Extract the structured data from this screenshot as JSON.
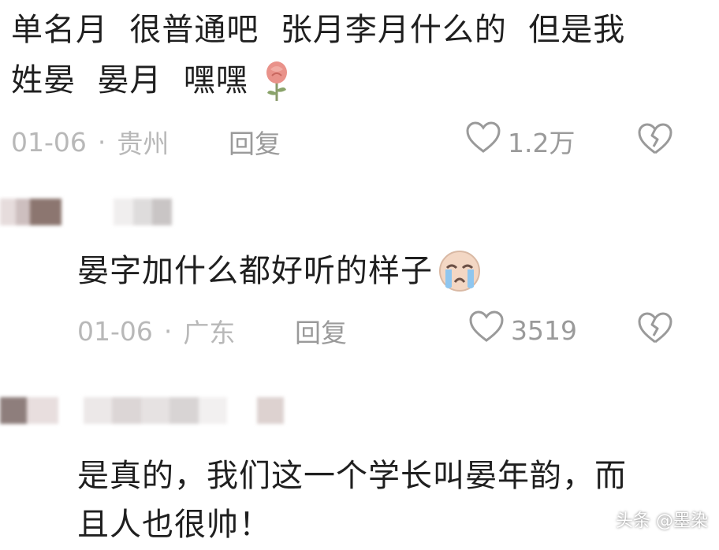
{
  "comments": [
    {
      "text_line1": "单名月  很普通吧  张月李月什么的  但是我",
      "text_line2": "姓晏  晏月  嘿嘿",
      "emoji_icon": "rose-icon",
      "date": "01-06",
      "separator": "·",
      "location": "贵州",
      "reply_label": "回复",
      "like_count": "1.2万"
    },
    {
      "text": "晏字加什么都好听的样子",
      "emoji_icon": "crying-face-icon",
      "date": "01-06",
      "separator": "·",
      "location": "广东",
      "reply_label": "回复",
      "like_count": "3519"
    },
    {
      "text_line1": "是真的，我们这一个学长叫晏年韵，而",
      "text_line2": "且人也很帅！"
    }
  ],
  "watermark": "头条 @墨染",
  "colors": {
    "meta": "#b8b8b8",
    "action": "#9a9a9a",
    "text": "#1f1f1f"
  }
}
